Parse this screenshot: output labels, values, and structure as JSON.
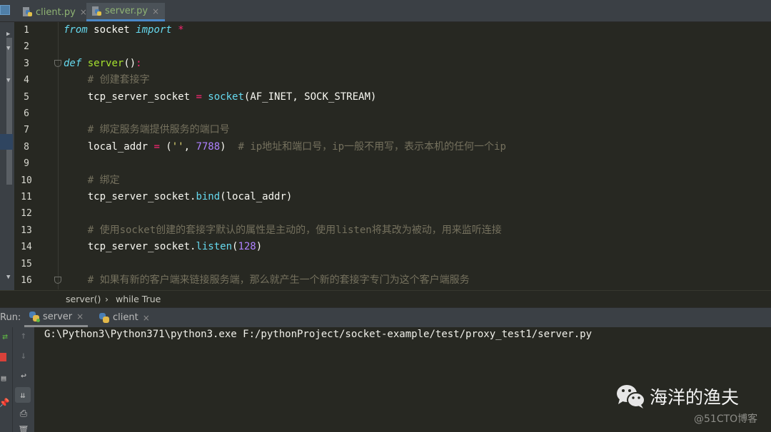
{
  "editor_tabs": [
    {
      "label": "client.py",
      "close": "×",
      "active": false
    },
    {
      "label": "server.py",
      "close": "×",
      "active": true
    }
  ],
  "line_numbers": [
    "1",
    "2",
    "3",
    "4",
    "5",
    "6",
    "7",
    "8",
    "9",
    "10",
    "11",
    "12",
    "13",
    "14",
    "15",
    "16"
  ],
  "code": {
    "l1": {
      "from": "from",
      "mod": " socket ",
      "imp": "import",
      "star": " *"
    },
    "l3": {
      "def": "def",
      "name": " server",
      "paren": "()",
      "colon": ":"
    },
    "l4": {
      "comment": "    # 创建套接字"
    },
    "l5": {
      "var": "    tcp_server_socket ",
      "eq": "=",
      "fn": " socket",
      "args": "(AF_INET, SOCK_STREAM)"
    },
    "l7": {
      "comment": "    # 绑定服务端提供服务的端口号"
    },
    "l8": {
      "var": "    local_addr ",
      "eq": "=",
      "open": " (",
      "str": "''",
      "comma": ", ",
      "num": "7788",
      "close": ")",
      "comment": "  # ip地址和端口号，ip一般不用写，表示本机的任何一个ip"
    },
    "l10": {
      "comment": "    # 绑定"
    },
    "l11": {
      "var": "    tcp_server_socket.",
      "fn": "bind",
      "args": "(local_addr)"
    },
    "l13": {
      "comment": "    # 使用socket创建的套接字默认的属性是主动的，使用listen将其改为被动，用来监听连接"
    },
    "l14": {
      "var": "    tcp_server_socket.",
      "fn": "listen",
      "open": "(",
      "num": "128",
      "close": ")"
    },
    "l16": {
      "comment": "    # 如果有新的客户端来链接服务端，那么就产生一个新的套接字专门为这个客户端服务"
    }
  },
  "breadcrumb": {
    "item1": "server()",
    "sep": "›",
    "item2": "while True"
  },
  "run_panel": {
    "label": "Run:",
    "tabs": [
      {
        "label": "server",
        "close": "×",
        "active": true
      },
      {
        "label": "client",
        "close": "×",
        "active": false
      }
    ],
    "console_output": "G:\\Python3\\Python371\\python3.exe F:/pythonProject/socket-example/test/proxy_test1/server.py"
  },
  "watermark": {
    "name": "海洋的渔夫",
    "source": "@51CTO博客"
  }
}
